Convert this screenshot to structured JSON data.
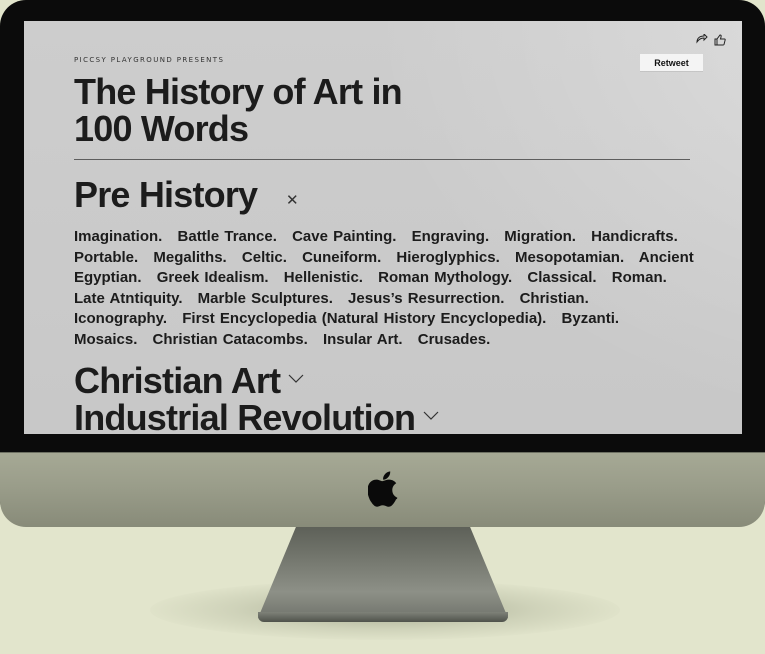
{
  "page": {
    "presents": "PICCSY PLAYGROUND PRESENTS",
    "title_line1": "The History of Art in",
    "title_line2": "100 Words"
  },
  "social": {
    "retweet_label": "Retweet",
    "icons": [
      "share-icon",
      "thumbs-up-icon"
    ]
  },
  "sections": [
    {
      "title": "Pre History",
      "expanded": true,
      "words": [
        "Imagination.",
        "Battle Trance.",
        "Cave Painting.",
        "Engraving.",
        "Migration.",
        "Handicrafts.",
        "Portable.",
        "Megaliths.",
        "Celtic.",
        "Cuneiform.",
        "Hieroglyphics.",
        "Mesopotamian.",
        "Ancient Egyptian.",
        "Greek Idealism.",
        "Hellenistic.",
        "Roman Mythology.",
        "Classical.",
        "Roman.",
        "Late Atntiquity.",
        "Marble Sculptures.",
        "Jesus’s Resurrection.",
        "Christian.",
        "Iconography.",
        "First Encyclopedia (Natural History Encyclopedia).",
        "Byzanti.",
        "Mosaics.",
        "Christian Catacombs.",
        "Insular Art.",
        "Crusades."
      ]
    },
    {
      "title": "Christian Art",
      "expanded": false
    },
    {
      "title": "Industrial Revolution",
      "expanded": false
    }
  ],
  "colors": {
    "background": "#e2e5cc",
    "screen": "#cdcdcd",
    "text": "#1c1c1c",
    "bezel": "#0b0b0b",
    "chin": "#9a9d8a"
  }
}
